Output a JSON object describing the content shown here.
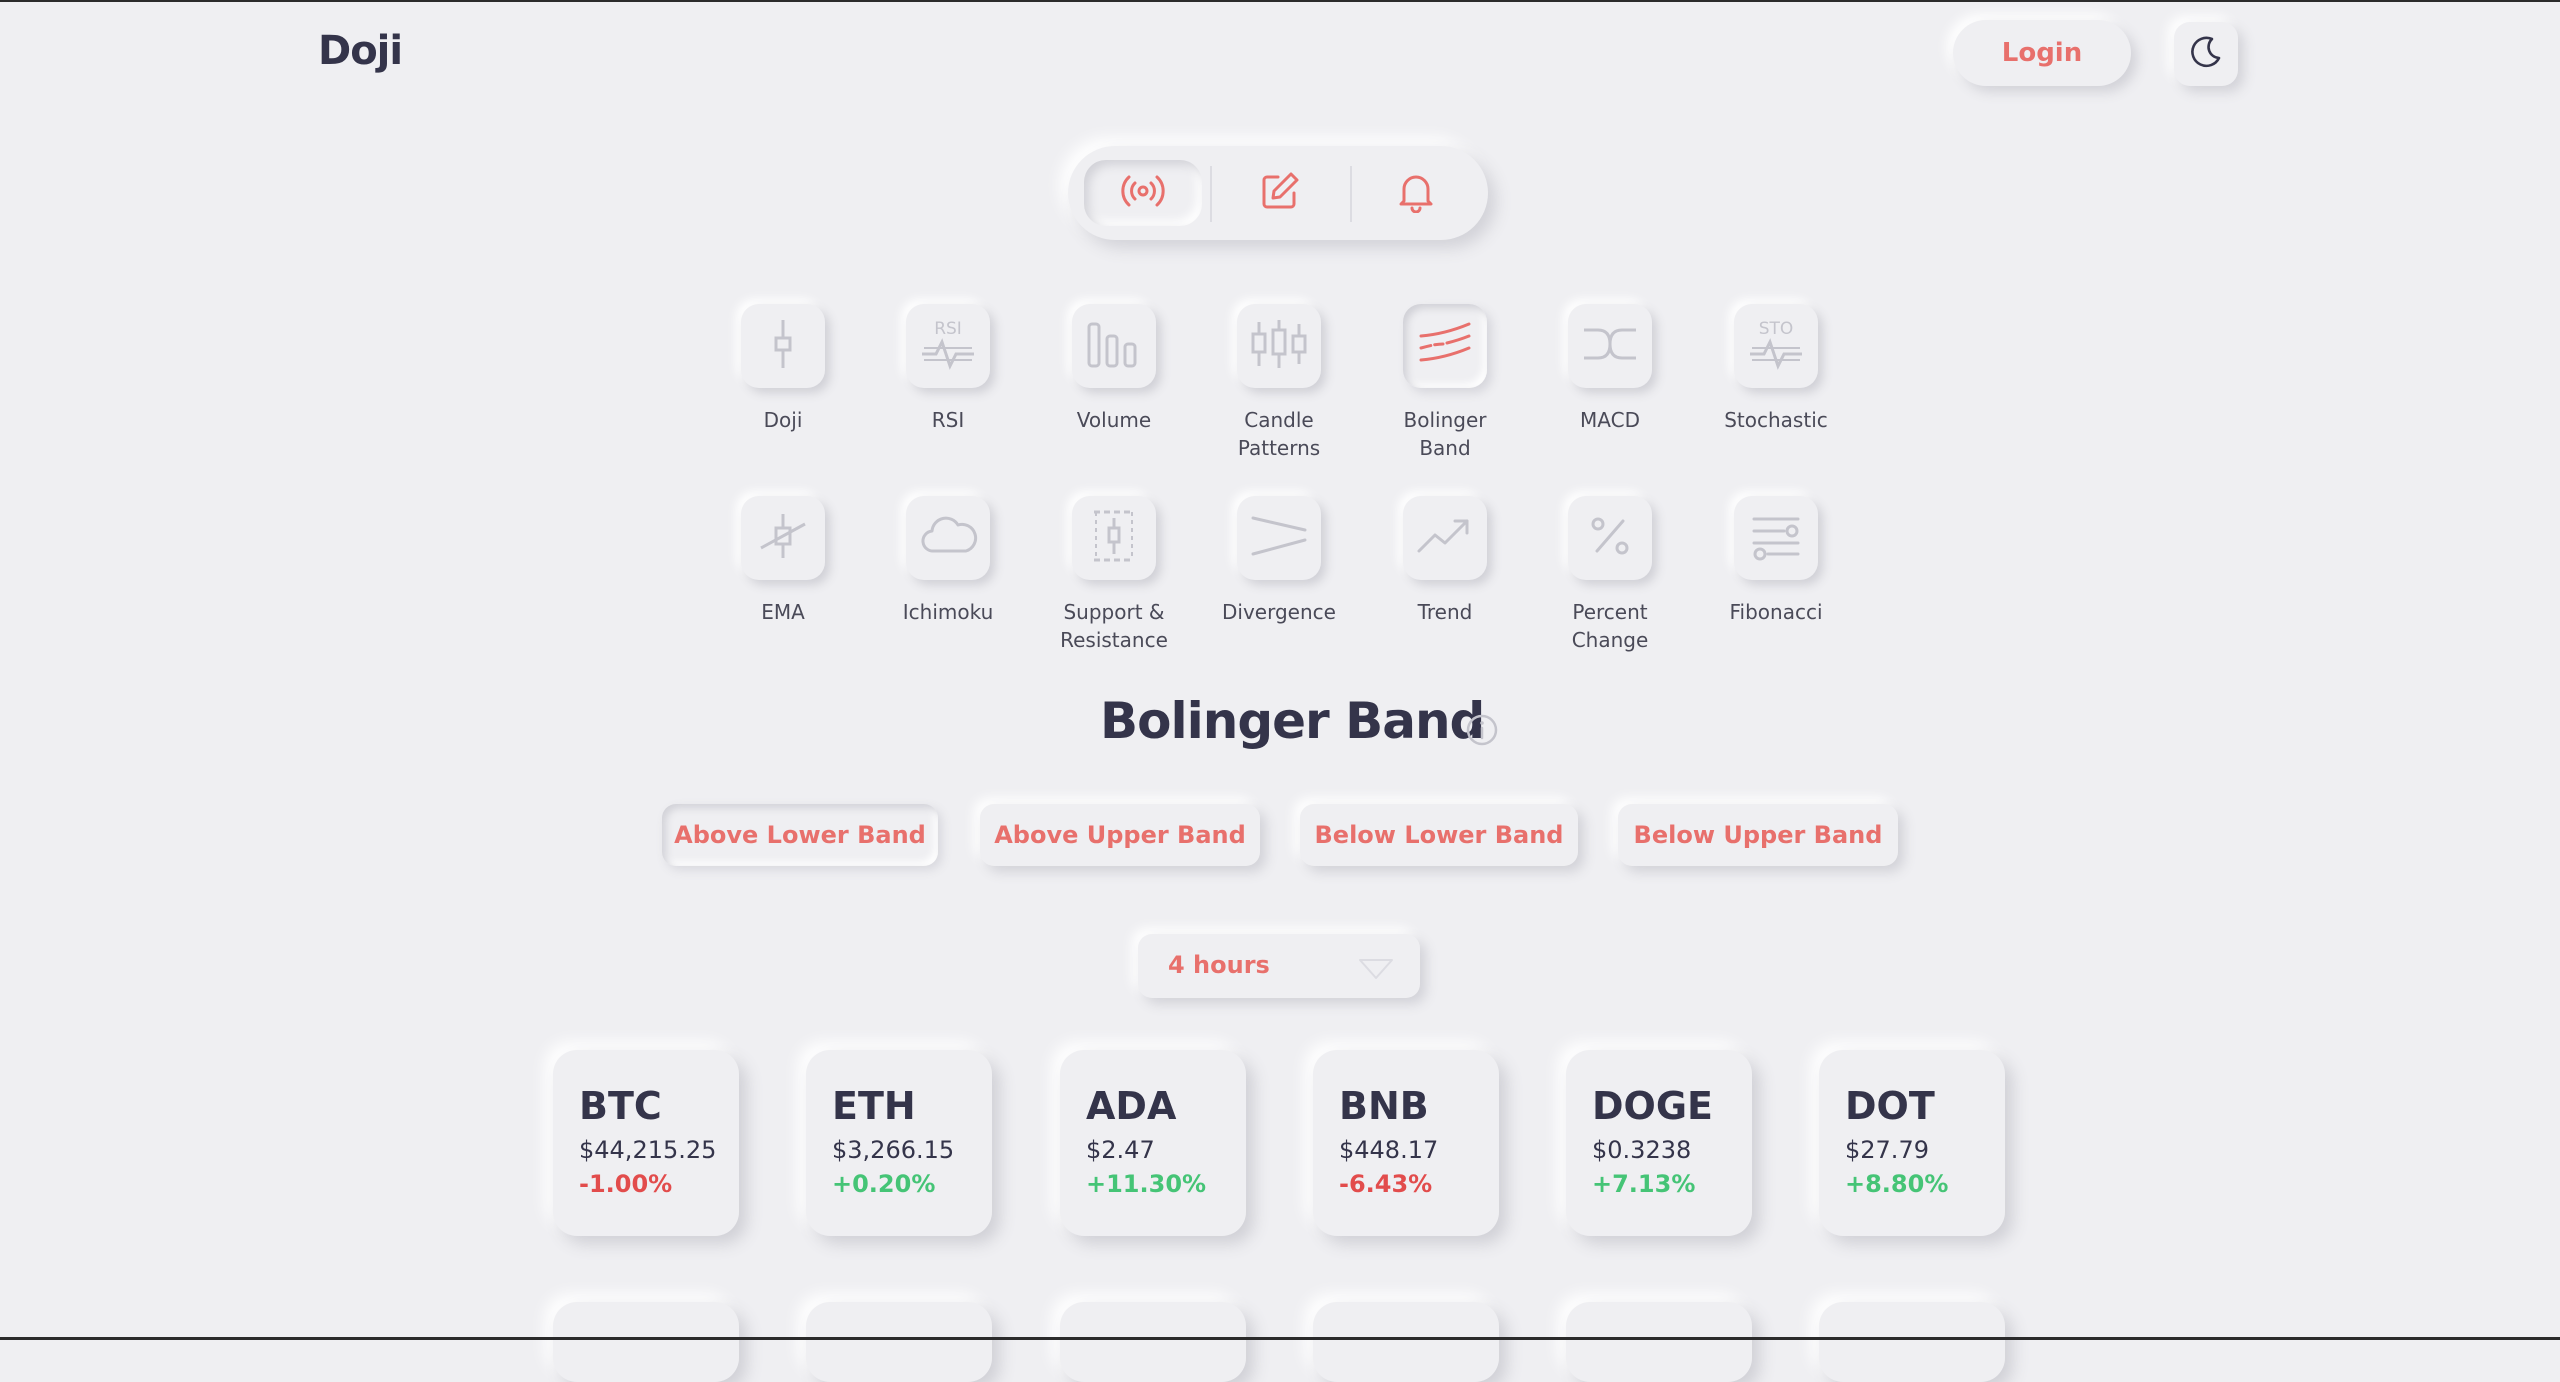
{
  "app": {
    "brand": "Doji"
  },
  "header": {
    "login_label": "Login",
    "theme_icon": "moon-icon"
  },
  "mode_bar": {
    "items": [
      {
        "icon": "broadcast-icon",
        "active": true
      },
      {
        "icon": "edit-icon",
        "active": false
      },
      {
        "icon": "bell-icon",
        "active": false
      }
    ]
  },
  "indicators": [
    {
      "label": "Doji",
      "icon": "doji-icon"
    },
    {
      "label": "RSI",
      "icon": "rsi-icon"
    },
    {
      "label": "Volume",
      "icon": "volume-icon"
    },
    {
      "label": "Candle\nPatterns",
      "icon": "candle-patterns-icon"
    },
    {
      "label": "Bolinger\nBand",
      "icon": "bolinger-band-icon",
      "active": true
    },
    {
      "label": "MACD",
      "icon": "macd-icon"
    },
    {
      "label": "Stochastic",
      "icon": "stochastic-icon"
    },
    {
      "label": "EMA",
      "icon": "ema-icon"
    },
    {
      "label": "Ichimoku",
      "icon": "cloud-icon"
    },
    {
      "label": "Support &\nResistance",
      "icon": "support-resistance-icon"
    },
    {
      "label": "Divergence",
      "icon": "divergence-icon"
    },
    {
      "label": "Trend",
      "icon": "trend-icon"
    },
    {
      "label": "Percent\nChange",
      "icon": "percent-icon"
    },
    {
      "label": "Fibonacci",
      "icon": "fibonacci-icon"
    }
  ],
  "section": {
    "title": "Bolinger Band"
  },
  "conditions": [
    {
      "label": "Above Lower Band",
      "active": true
    },
    {
      "label": "Above Upper Band"
    },
    {
      "label": "Below Lower Band"
    },
    {
      "label": "Below Upper Band"
    }
  ],
  "timeframe": {
    "value": "4 hours"
  },
  "coins": [
    {
      "symbol": "BTC",
      "price": "$44,215.25",
      "change": "-1.00%",
      "direction": "down"
    },
    {
      "symbol": "ETH",
      "price": "$3,266.15",
      "change": "+0.20%",
      "direction": "up"
    },
    {
      "symbol": "ADA",
      "price": "$2.47",
      "change": "+11.30%",
      "direction": "up"
    },
    {
      "symbol": "BNB",
      "price": "$448.17",
      "change": "-6.43%",
      "direction": "down"
    },
    {
      "symbol": "DOGE",
      "price": "$0.3238",
      "change": "+7.13%",
      "direction": "up"
    },
    {
      "symbol": "DOT",
      "price": "$27.79",
      "change": "+8.80%",
      "direction": "up"
    }
  ],
  "colors": {
    "accent": "#e8706c",
    "positive": "#45c476",
    "negative": "#e24c4c",
    "background": "#efeff2",
    "text": "#34344a"
  }
}
